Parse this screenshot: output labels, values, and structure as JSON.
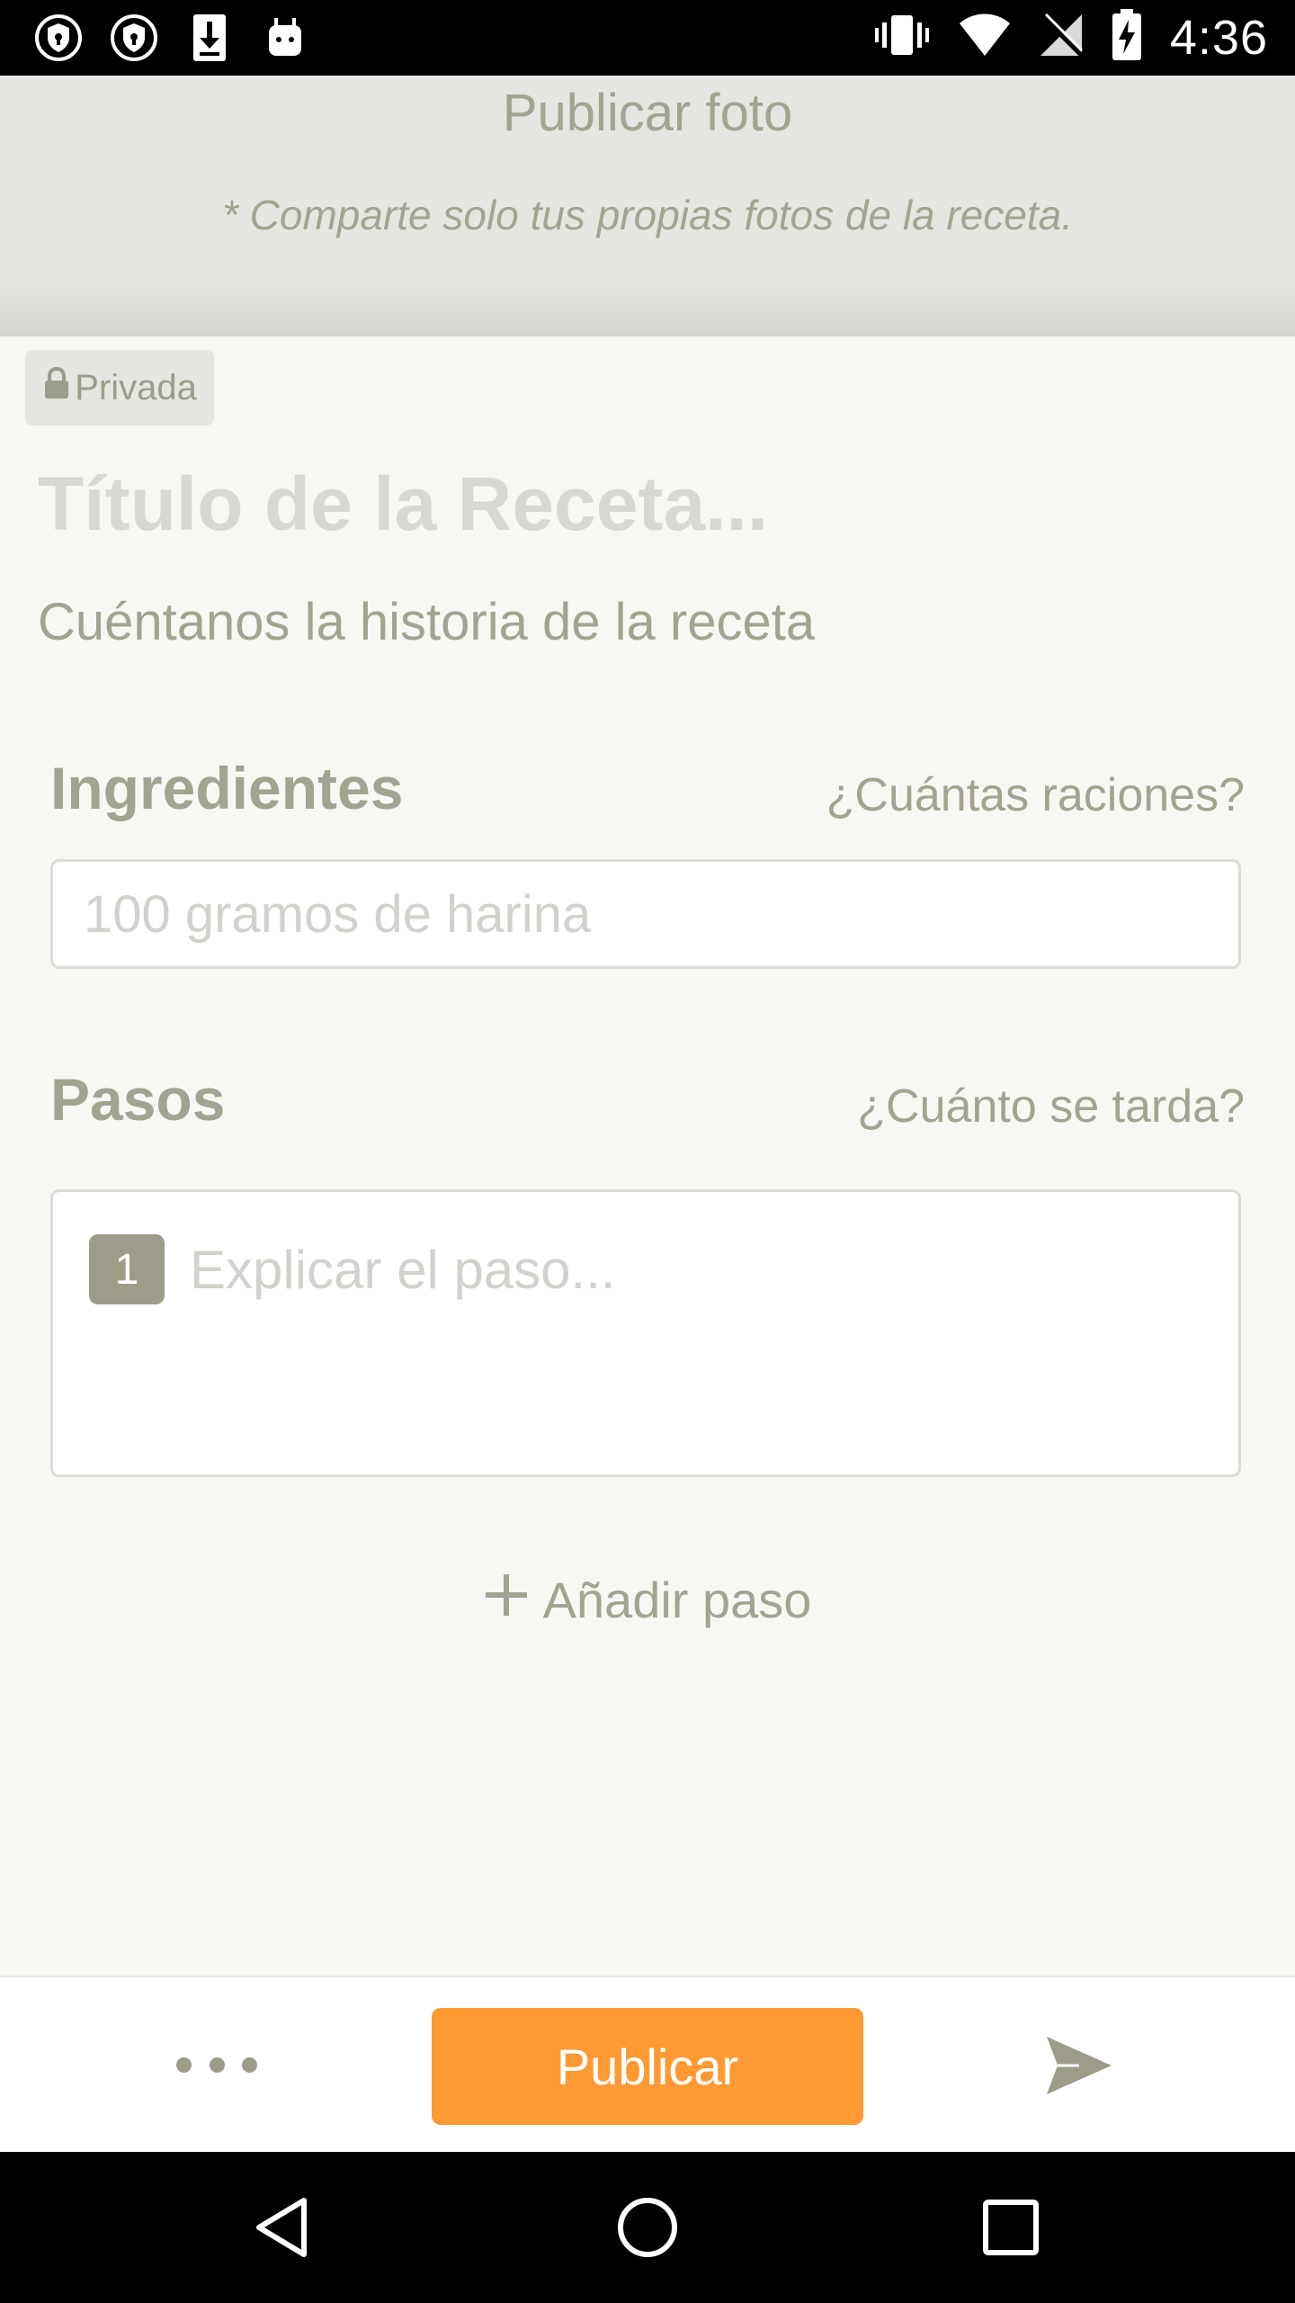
{
  "status_bar": {
    "time": "4:36",
    "left_icons": [
      "shield-lock-icon",
      "shield-lock-icon",
      "download-icon",
      "android-icon"
    ],
    "right_icons": [
      "vibrate-icon",
      "wifi-icon",
      "no-signal-icon",
      "battery-charging-icon"
    ]
  },
  "photo": {
    "title": "Publicar foto",
    "note": "* Comparte solo tus propias fotos de la receta."
  },
  "privacy": {
    "label": "Privada",
    "icon": "lock-icon"
  },
  "recipe": {
    "title_placeholder": "Título de la Receta...",
    "story_placeholder": "Cuéntanos la historia de la receta"
  },
  "ingredients": {
    "heading": "Ingredientes",
    "servings_link": "¿Cuántas raciones?",
    "input_placeholder": "100 gramos de harina"
  },
  "steps": {
    "heading": "Pasos",
    "time_link": "¿Cuánto se tarda?",
    "items": [
      {
        "number": "1",
        "placeholder": "Explicar el paso..."
      }
    ],
    "add_label": "Añadir paso"
  },
  "bottom_bar": {
    "more_icon": "more-horizontal-icon",
    "publish_label": "Publicar",
    "send_icon": "send-icon"
  },
  "nav_bar": {
    "icons": [
      "back-icon",
      "home-icon",
      "recents-icon"
    ]
  },
  "colors": {
    "accent": "#ff9933",
    "muted_text": "#a3a392",
    "placeholder": "#d2d1cc",
    "background": "#f8f7f3"
  }
}
